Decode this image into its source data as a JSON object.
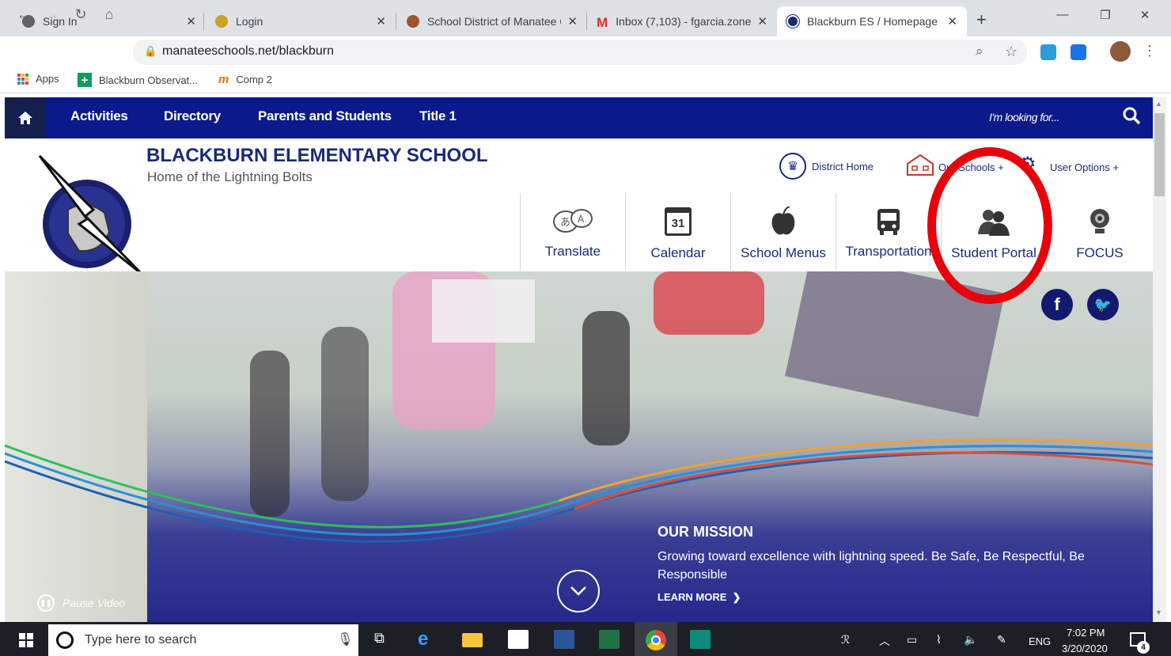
{
  "browser": {
    "tabs": [
      {
        "title": "Sign In",
        "close": "✕"
      },
      {
        "title": "Login",
        "close": "✕"
      },
      {
        "title": "School District of Manatee C",
        "close": "✕"
      },
      {
        "title": "Inbox (7,103) - fgarcia.zone",
        "close": "✕"
      },
      {
        "title": "Blackburn ES / Homepage",
        "close": "✕"
      }
    ],
    "new_tab": "+",
    "url": "manateeschools.net/blackburn",
    "bookmarks": [
      "Apps",
      "Blackburn Observat...",
      "Comp 2"
    ]
  },
  "site_nav": {
    "items": [
      "Activities",
      "Directory",
      "Parents and Students",
      "Title 1"
    ],
    "search_placeholder": "I'm looking for..."
  },
  "header": {
    "school_name": "BLACKBURN ELEMENTARY SCHOOL",
    "tagline": "Home of the Lightning Bolts",
    "links": [
      "District Home",
      "Our Schools +",
      "User Options +"
    ]
  },
  "quick_links": [
    "Translate",
    "Calendar",
    "School Menus",
    "Transportation",
    "Student Portal",
    "FOCUS"
  ],
  "calendar_day": "31",
  "hero": {
    "mission_title": "OUR MISSION",
    "mission_text": "Growing toward excellence with lightning speed. Be Safe, Be Respectful, Be Responsible",
    "learn_more": "LEARN MORE",
    "pause": "Pause Video"
  },
  "taskbar": {
    "search": "Type here to search",
    "lang": "ENG",
    "time": "7:02 PM",
    "date": "3/20/2020",
    "notifications": "4"
  },
  "colors": {
    "nav": "#0a1a8a",
    "highlight_circle": "#e8000b",
    "text_blue": "#1a2a7a"
  }
}
